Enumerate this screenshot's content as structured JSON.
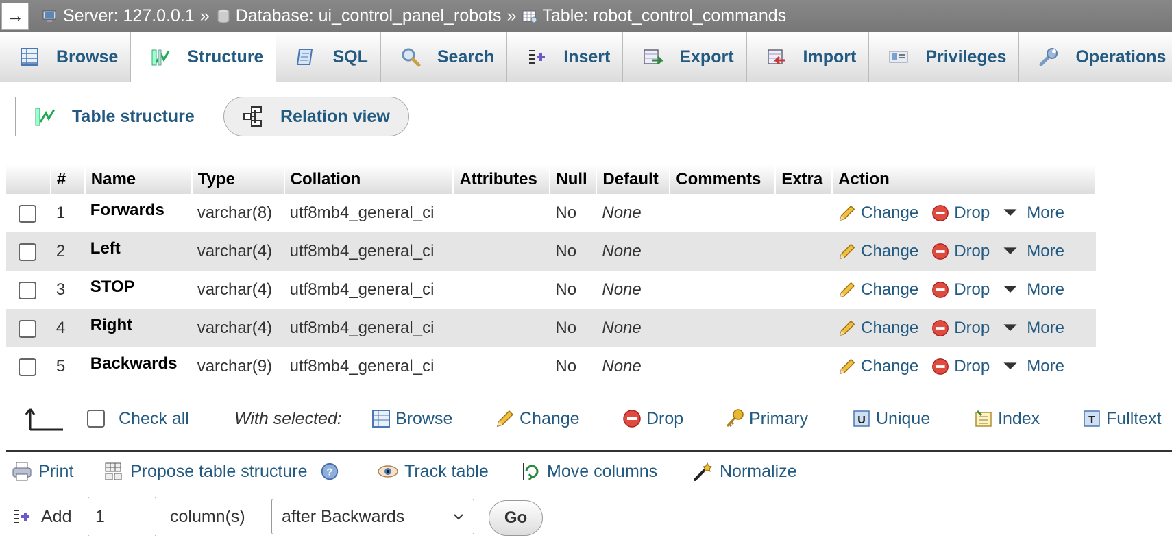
{
  "breadcrumb": {
    "back_glyph": "→",
    "server": "Server: 127.0.0.1",
    "separator": "»",
    "database": "Database: ui_control_panel_robots",
    "table": "Table: robot_control_commands"
  },
  "tabs": [
    {
      "label": "Browse",
      "icon": "browse-icon"
    },
    {
      "label": "Structure",
      "icon": "structure-icon",
      "active": true
    },
    {
      "label": "SQL",
      "icon": "sql-icon"
    },
    {
      "label": "Search",
      "icon": "search-icon"
    },
    {
      "label": "Insert",
      "icon": "insert-icon"
    },
    {
      "label": "Export",
      "icon": "export-icon"
    },
    {
      "label": "Import",
      "icon": "import-icon"
    },
    {
      "label": "Privileges",
      "icon": "privileges-icon"
    },
    {
      "label": "Operations",
      "icon": "operations-icon"
    }
  ],
  "subtabs": {
    "table_structure": "Table structure",
    "relation_view": "Relation view"
  },
  "columns_table": {
    "headers": [
      "#",
      "Name",
      "Type",
      "Collation",
      "Attributes",
      "Null",
      "Default",
      "Comments",
      "Extra",
      "Action"
    ],
    "rows": [
      {
        "num": "1",
        "name": "Forwards",
        "type": "varchar(8)",
        "collation": "utf8mb4_general_ci",
        "attributes": "",
        "null": "No",
        "default": "None",
        "comments": "",
        "extra": ""
      },
      {
        "num": "2",
        "name": "Left",
        "type": "varchar(4)",
        "collation": "utf8mb4_general_ci",
        "attributes": "",
        "null": "No",
        "default": "None",
        "comments": "",
        "extra": ""
      },
      {
        "num": "3",
        "name": "STOP",
        "type": "varchar(4)",
        "collation": "utf8mb4_general_ci",
        "attributes": "",
        "null": "No",
        "default": "None",
        "comments": "",
        "extra": ""
      },
      {
        "num": "4",
        "name": "Right",
        "type": "varchar(4)",
        "collation": "utf8mb4_general_ci",
        "attributes": "",
        "null": "No",
        "default": "None",
        "comments": "",
        "extra": ""
      },
      {
        "num": "5",
        "name": "Backwards",
        "type": "varchar(9)",
        "collation": "utf8mb4_general_ci",
        "attributes": "",
        "null": "No",
        "default": "None",
        "comments": "",
        "extra": ""
      }
    ],
    "actions": {
      "change": "Change",
      "drop": "Drop",
      "more": "More"
    }
  },
  "bulk": {
    "check_all": "Check all",
    "with_selected": "With selected:",
    "browse": "Browse",
    "change": "Change",
    "drop": "Drop",
    "primary": "Primary",
    "unique": "Unique",
    "index": "Index",
    "fulltext": "Fulltext"
  },
  "tools": {
    "print": "Print",
    "propose": "Propose table structure",
    "track": "Track table",
    "move": "Move columns",
    "normalize": "Normalize"
  },
  "add_column": {
    "add_label": "Add",
    "count_value": "1",
    "columns_label": "column(s)",
    "position": "after Backwards",
    "go": "Go"
  }
}
